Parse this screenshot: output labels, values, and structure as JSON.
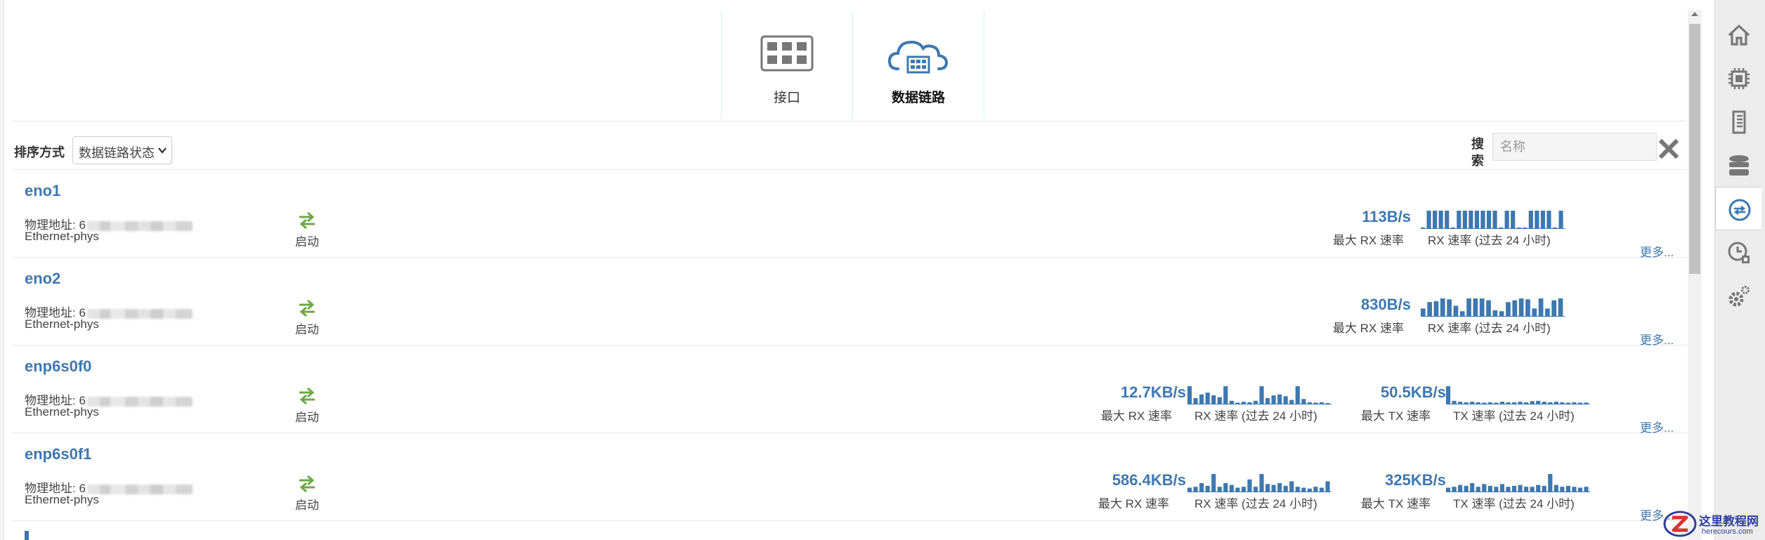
{
  "tabs": [
    {
      "label": "接口",
      "icon": "grid-icon",
      "active": false
    },
    {
      "label": "数据链路",
      "icon": "cloud-datalink-icon",
      "active": true
    }
  ],
  "toolbar": {
    "sort_label": "排序方式",
    "sort_value": "数据链路状态",
    "search_label": "搜索",
    "search_placeholder": "名称"
  },
  "links": [
    {
      "name": "eno1",
      "mac_label": "物理地址: 6",
      "type": "Ethernet-phys",
      "state": "启动",
      "rx_max": "113B/s",
      "rx_max_label": "最大 RX 速率",
      "rx_spark_label": "RX 速率 (过去 24 小时)",
      "rx_spark": [
        0.08,
        1,
        1,
        1,
        1,
        0.08,
        1,
        1,
        1,
        1,
        1,
        1,
        1,
        0.08,
        1,
        1,
        0.08,
        0.08,
        1,
        1,
        1,
        1,
        0.08,
        1
      ],
      "more": "更多..."
    },
    {
      "name": "eno2",
      "mac_label": "物理地址: 6",
      "type": "Ethernet-phys",
      "state": "启动",
      "rx_max": "830B/s",
      "rx_max_label": "最大 RX 速率",
      "rx_spark_label": "RX 速率 (过去 24 小时)",
      "rx_spark": [
        0.45,
        0.8,
        0.85,
        1,
        0.95,
        0.6,
        0.3,
        1,
        1,
        1,
        0.9,
        0.35,
        0.3,
        0.8,
        0.9,
        1,
        0.95,
        0.45,
        1,
        0.45,
        0.9,
        1
      ],
      "more": "更多..."
    },
    {
      "name": "enp6s0f0",
      "mac_label": "物理地址: 6",
      "type": "Ethernet-phys",
      "state": "启动",
      "rx_max": "12.7KB/s",
      "rx_max_label": "最大 RX 速率",
      "rx_spark_label": "RX 速率 (过去 24 小时)",
      "rx_spark": [
        1,
        0.35,
        0.55,
        0.65,
        0.5,
        0.4,
        1,
        0.2,
        0.1,
        0.15,
        0.12,
        0.2,
        1,
        0.35,
        0.5,
        0.55,
        0.45,
        0.25,
        1,
        0.3,
        0.12,
        0.1,
        0.12,
        0.08
      ],
      "tx_max": "50.5KB/s",
      "tx_max_label": "最大 TX 速率",
      "tx_spark_label": "TX 速率 (过去 24 小时)",
      "tx_spark": [
        1,
        0.2,
        0.15,
        0.12,
        0.15,
        0.12,
        0.1,
        0.12,
        0.1,
        0.15,
        0.12,
        0.12,
        0.15,
        0.12,
        0.18,
        0.2,
        0.15,
        0.12,
        0.15,
        0.12,
        0.1,
        0.12,
        0.1,
        0.1
      ],
      "more": "更多..."
    },
    {
      "name": "enp6s0f1",
      "mac_label": "物理地址: 6",
      "type": "Ethernet-phys",
      "state": "启动",
      "rx_max": "586.4KB/s",
      "rx_max_label": "最大 RX 速率",
      "rx_spark_label": "RX 速率 (过去 24 小时)",
      "rx_spark": [
        0.25,
        0.3,
        0.5,
        0.35,
        1,
        0.3,
        0.5,
        0.4,
        0.25,
        0.3,
        0.7,
        0.3,
        1,
        0.45,
        0.4,
        0.5,
        0.35,
        0.6,
        0.3,
        0.25,
        0.2,
        0.3,
        0.25,
        0.6
      ],
      "tx_max": "325KB/s",
      "tx_max_label": "最大 TX 速率",
      "tx_spark_label": "TX 速率 (过去 24 小时)",
      "tx_spark": [
        0.25,
        0.3,
        0.4,
        0.35,
        0.5,
        0.3,
        0.45,
        0.35,
        0.3,
        0.45,
        0.3,
        0.35,
        0.4,
        0.3,
        0.3,
        0.4,
        0.35,
        1,
        0.4,
        0.3,
        0.35,
        0.3,
        0.25,
        0.3
      ],
      "more": "更多..."
    }
  ],
  "sidebar": [
    {
      "icon": "home-icon",
      "active": false
    },
    {
      "icon": "processor-icon",
      "active": false
    },
    {
      "icon": "memory-icon",
      "active": false
    },
    {
      "icon": "storage-icon",
      "active": false
    },
    {
      "icon": "network-icon",
      "active": true
    },
    {
      "icon": "scheduled-tasks-icon",
      "active": false
    },
    {
      "icon": "settings-icon",
      "active": false
    }
  ],
  "watermark": {
    "title": "这里教程网",
    "subtitle": "herecours.com"
  },
  "colors": {
    "accent": "#3d78b0",
    "state_green": "#6fa843",
    "sidebar_icon": "#777777"
  }
}
